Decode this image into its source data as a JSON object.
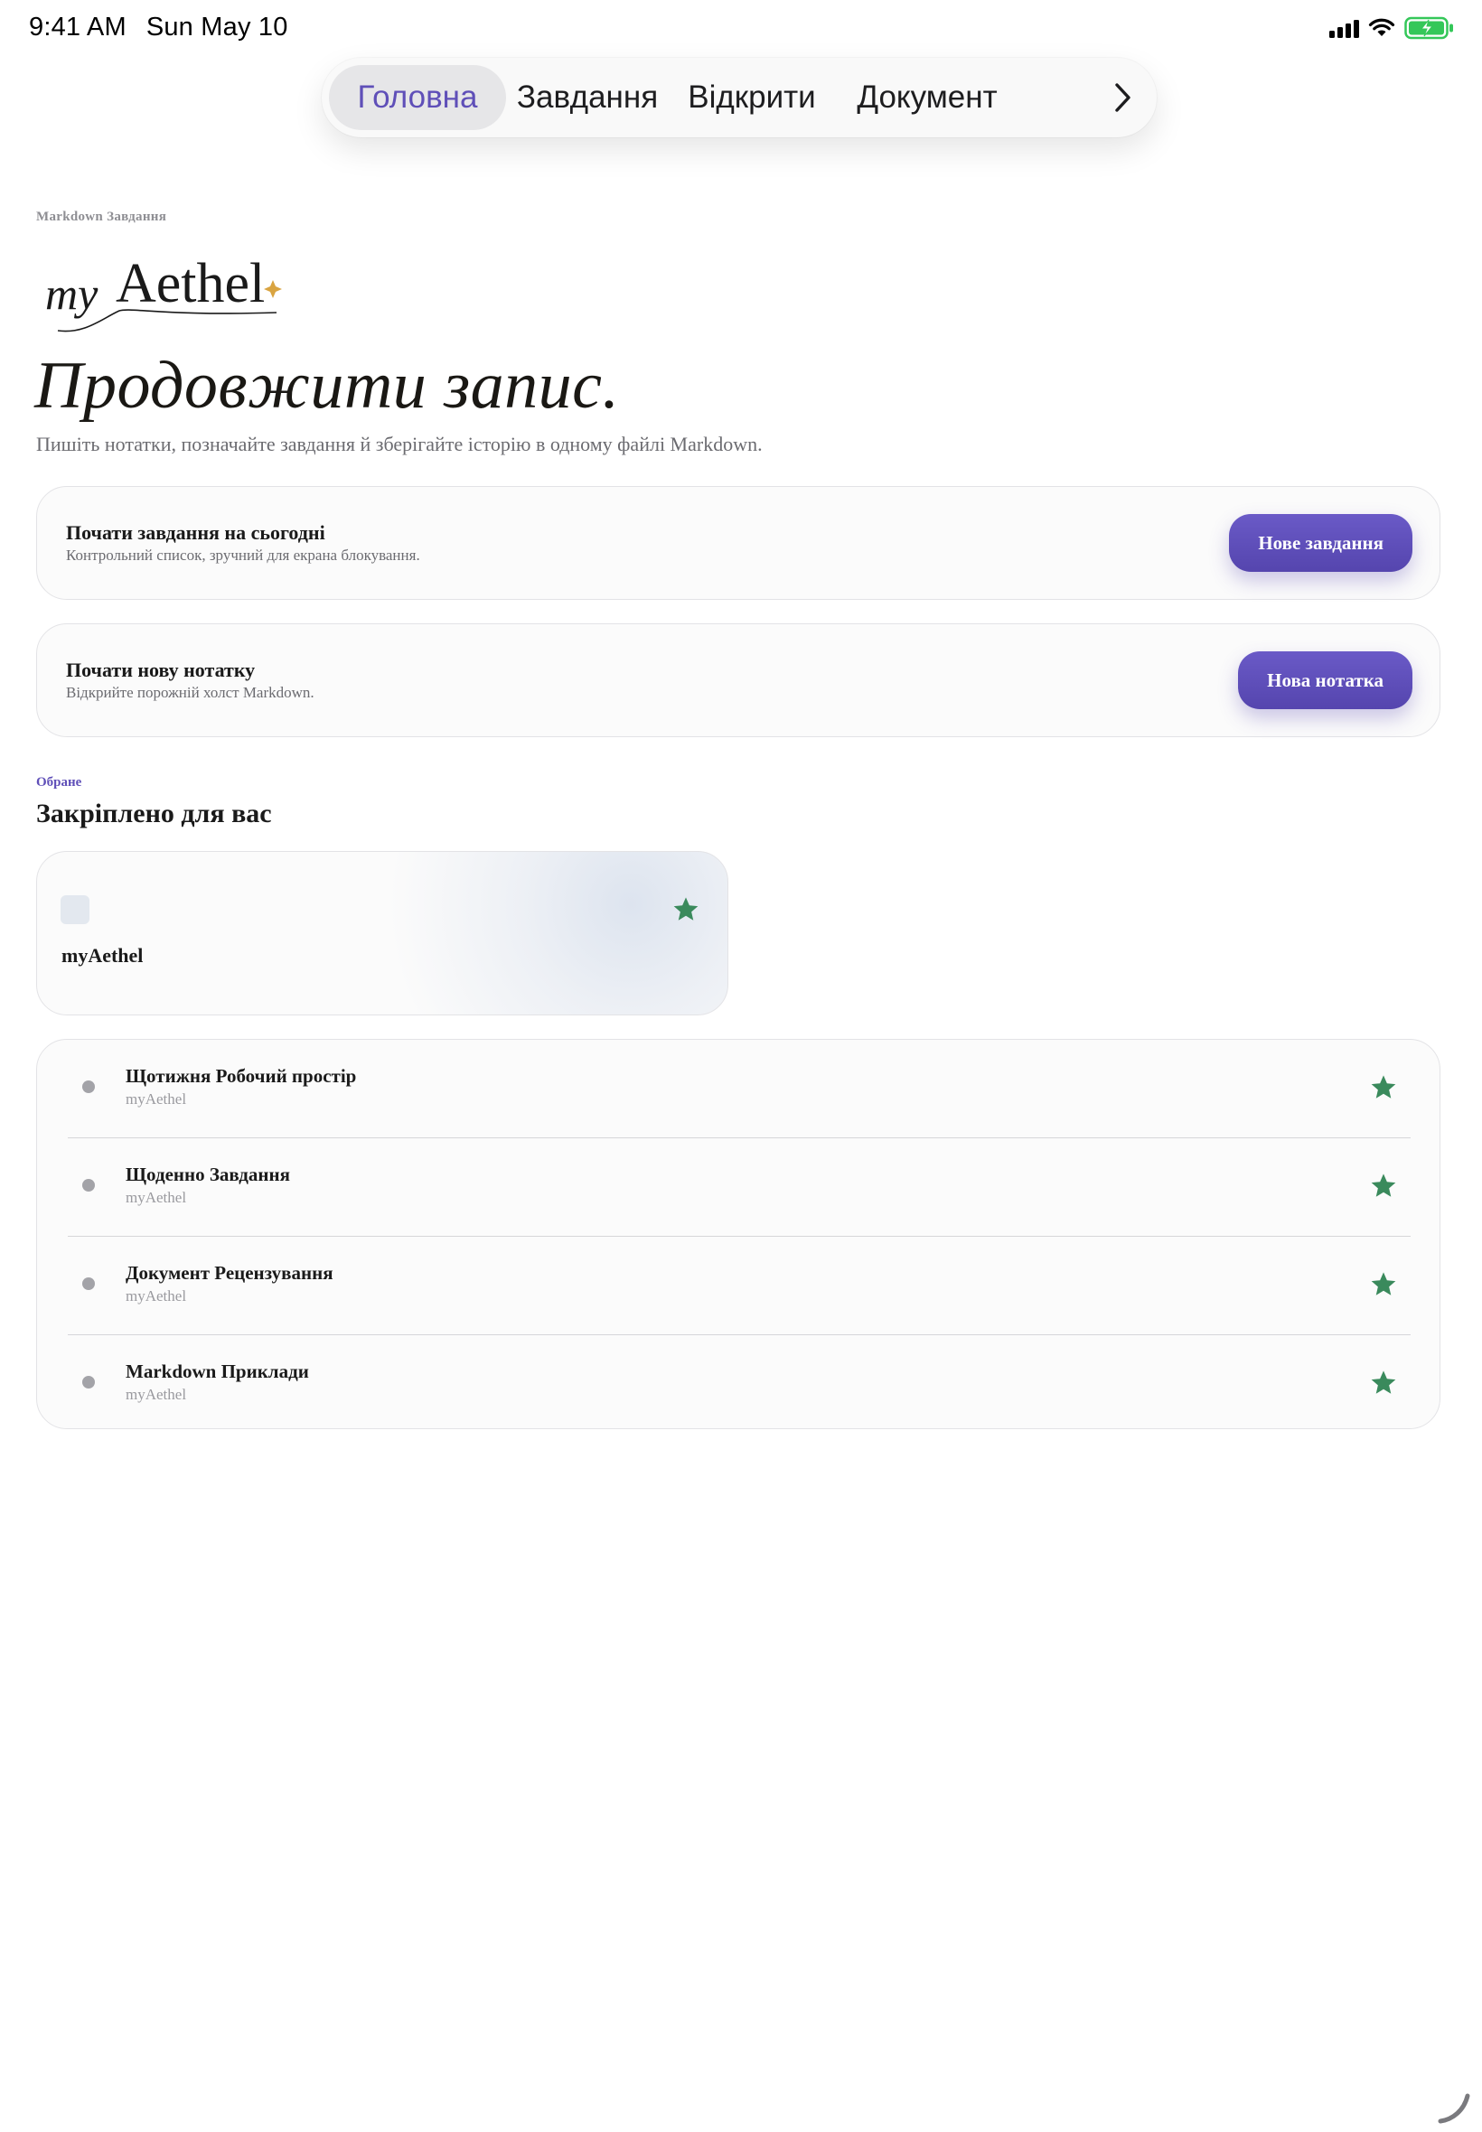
{
  "status_bar": {
    "time": "9:41 AM",
    "date": "Sun May 10",
    "icons": [
      "cellular-signal-icon",
      "wifi-icon",
      "battery-charging-icon"
    ]
  },
  "tabs": [
    {
      "label": "Головна",
      "active": true
    },
    {
      "label": "Завдання",
      "active": false
    },
    {
      "label": "Відкрити",
      "active": false
    },
    {
      "label": "Документ",
      "active": false
    }
  ],
  "tabs_more_icon": "chevron-right-icon",
  "header": {
    "eyebrow": "Markdown Завдання",
    "logo_text": "myAethel",
    "title": "Продовжити запис.",
    "subtitle": "Пишіть нотатки, позначайте завдання й зберігайте історію в одному файлі Markdown."
  },
  "actions": [
    {
      "title": "Почати завдання на сьогодні",
      "description": "Контрольний список, зручний для екрана блокування.",
      "button": "Нове завдання"
    },
    {
      "title": "Почати нову нотатку",
      "description": "Відкрийте порожній холст Markdown.",
      "button": "Нова нотатка"
    }
  ],
  "favorites": {
    "kicker": "Обране",
    "title": "Закріплено для вас",
    "pinned": {
      "name": "myAethel"
    },
    "items": [
      {
        "title": "Щотижня Робочий простір",
        "subtitle": "myAethel"
      },
      {
        "title": "Щоденно Завдання",
        "subtitle": "myAethel"
      },
      {
        "title": "Документ Рецензування",
        "subtitle": "myAethel"
      },
      {
        "title": "Markdown Приклади",
        "subtitle": "myAethel"
      }
    ]
  },
  "colors": {
    "accent": "#5f4fb8",
    "star": "#3a8a5c",
    "battery": "#34c759",
    "logo_sparkle": "#d9a441"
  }
}
